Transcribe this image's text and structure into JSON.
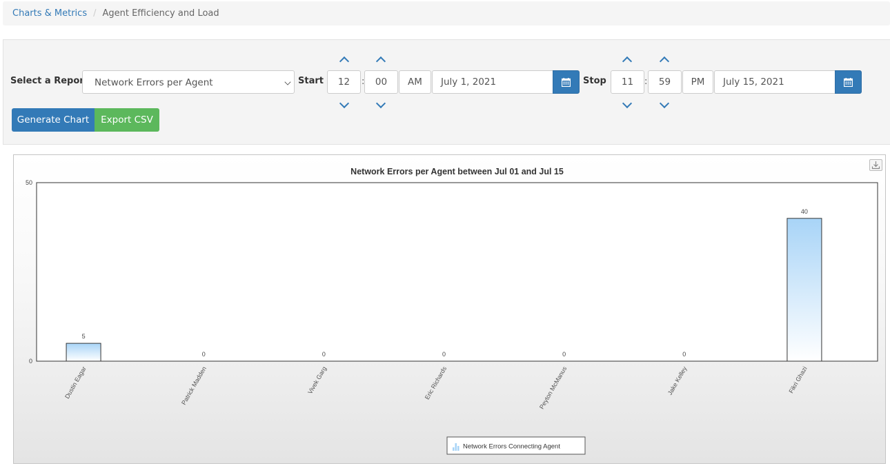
{
  "breadcrumb": {
    "parent": "Charts & Metrics",
    "separator": "/",
    "current": "Agent Efficiency and Load"
  },
  "controls": {
    "select_label": "Select a Report",
    "report_selected": "Network Errors per Agent",
    "start_label": "Start",
    "start_hour": "12",
    "start_minute": "00",
    "start_ampm": "AM",
    "start_date": "July 1, 2021",
    "stop_label": "Stop",
    "stop_hour": "11",
    "stop_minute": "59",
    "stop_ampm": "PM",
    "stop_date": "July 15, 2021",
    "time_separator": ":",
    "generate_label": "Generate Chart",
    "export_label": "Export CSV"
  },
  "icons": {
    "calendar": "calendar-icon",
    "chevron_up": "chevron-up-icon",
    "chevron_down": "chevron-down-icon",
    "export": "download-icon",
    "legend": "bar-chart-icon"
  },
  "colors": {
    "primary": "#337ab7",
    "success": "#5cb85c",
    "bar_top": "#a8d4f7",
    "bar_bottom": "#ffffff"
  },
  "chart_data": {
    "type": "bar",
    "title": "Network Errors per Agent between Jul 01 and Jul 15",
    "categories": [
      "Dustin Eagar",
      "Patrick Madden",
      "Vivek Garg",
      "Eric Richards",
      "Peyton McManus",
      "Jake Kelley",
      "Fikri Ghazi"
    ],
    "series": [
      {
        "name": "Network Errors Connecting Agent",
        "values": [
          5,
          0,
          0,
          0,
          0,
          0,
          40
        ]
      }
    ],
    "ylim": [
      0,
      50
    ],
    "yticks": [
      0,
      50
    ],
    "xlabel": "",
    "ylabel": "",
    "grid": false,
    "legend": "bottom-center"
  }
}
